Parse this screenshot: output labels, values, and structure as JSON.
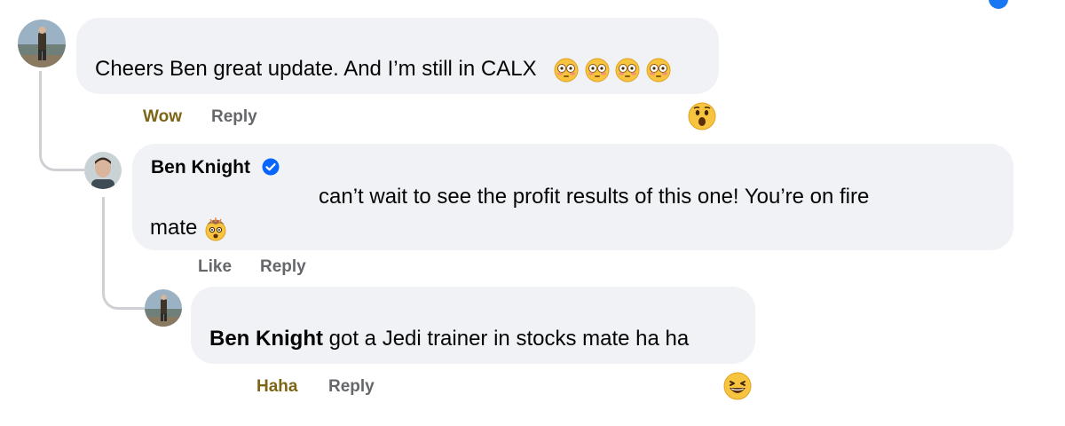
{
  "comments": [
    {
      "author": "",
      "text": "Cheers Ben great update. And I’m still in CALX",
      "emoji_icons": [
        "flushed-face-icon",
        "flushed-face-icon",
        "flushed-face-icon",
        "flushed-face-icon"
      ],
      "actions": {
        "reaction_label": "Wow",
        "reply_label": "Reply"
      },
      "reaction_icon": "surprised-face-icon",
      "reaction_color": "#7c6516"
    },
    {
      "author": "Ben Knight",
      "verified_icon": "verified-badge-icon",
      "text_line1": "can’t wait to see the profit results of this one! You’re on fire",
      "text_line2": "mate",
      "emoji_icon": "exploding-head-icon",
      "actions": {
        "reaction_label": "Like",
        "reply_label": "Reply"
      }
    },
    {
      "mention": "Ben Knight",
      "text": " got a Jedi trainer in stocks mate ha ha",
      "actions": {
        "reaction_label": "Haha",
        "reply_label": "Reply"
      },
      "reaction_icon": "laughing-face-icon",
      "reaction_color": "#7c6516"
    }
  ],
  "colors": {
    "bubble": "#f0f2f5",
    "verified": "#0866ff",
    "action_text": "#65676b",
    "thread_line": "#ced0d4"
  }
}
